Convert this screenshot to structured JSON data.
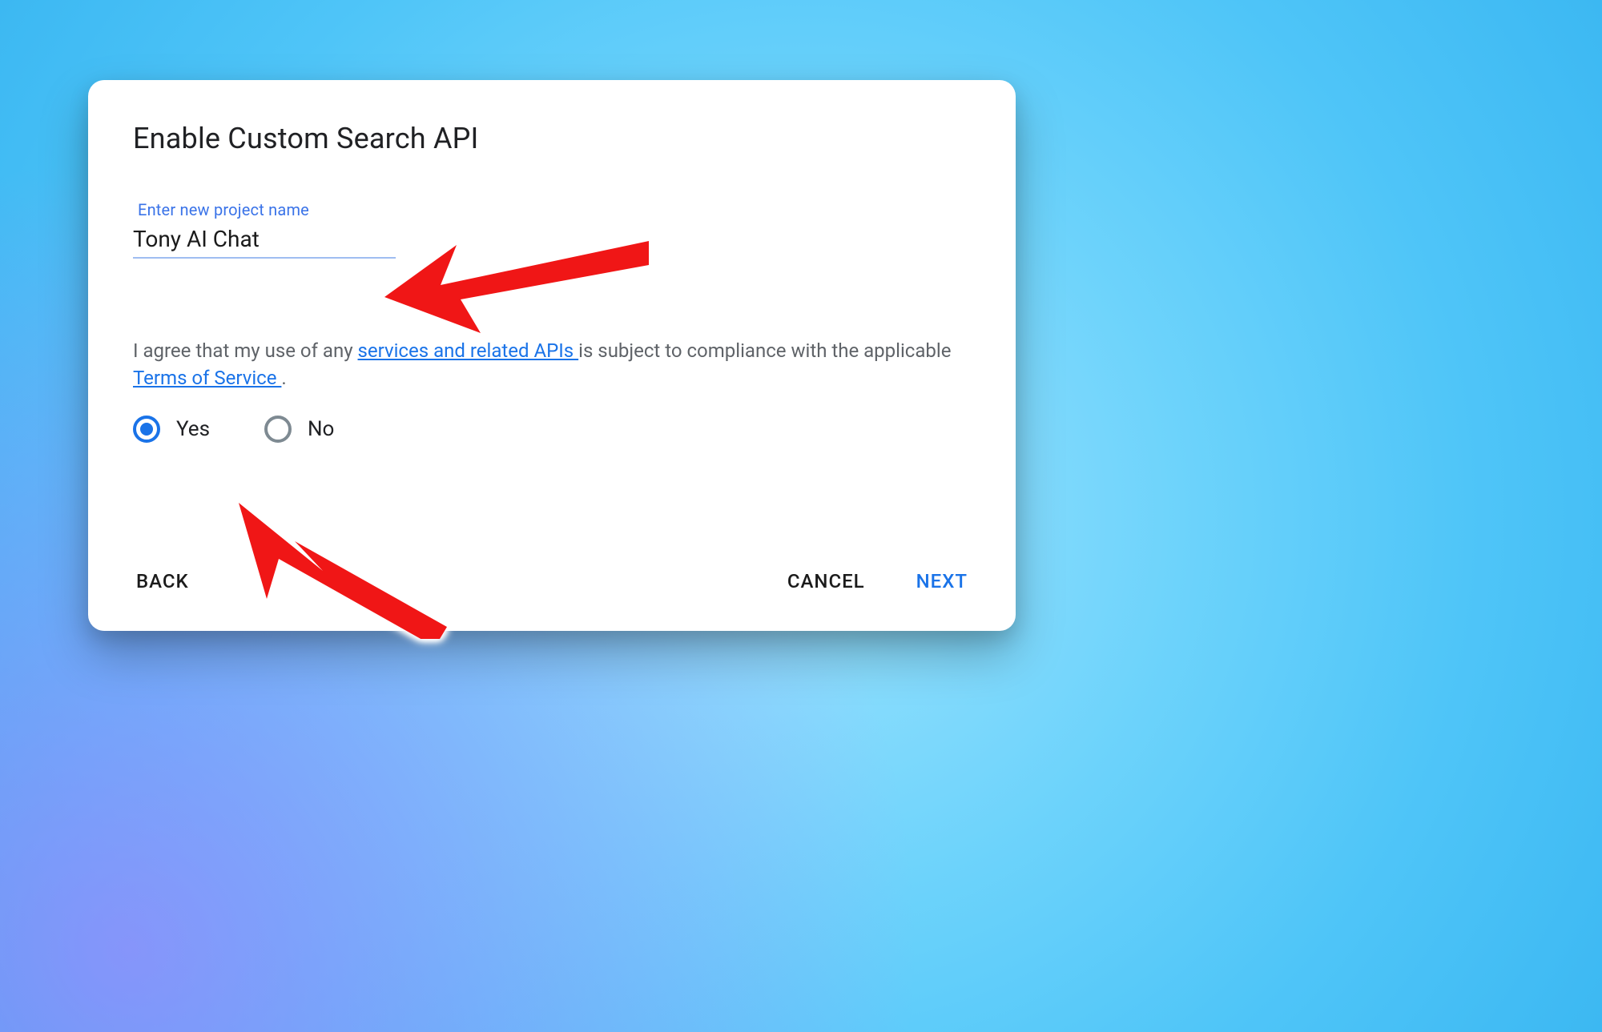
{
  "dialog": {
    "title": "Enable Custom Search API",
    "project_field": {
      "label": "Enter new project name",
      "value": "Tony AI Chat"
    },
    "agreement": {
      "text_before": "I agree that my use of any ",
      "link1": "services and related APIs ",
      "text_middle": "is subject to compliance with the applicable ",
      "link2": "Terms of Service ",
      "text_after": "."
    },
    "radios": {
      "yes": "Yes",
      "no": "No",
      "selected": "yes"
    },
    "buttons": {
      "back": "BACK",
      "cancel": "CANCEL",
      "next": "NEXT"
    }
  },
  "annotations": {
    "arrow_color": "#f01616"
  }
}
